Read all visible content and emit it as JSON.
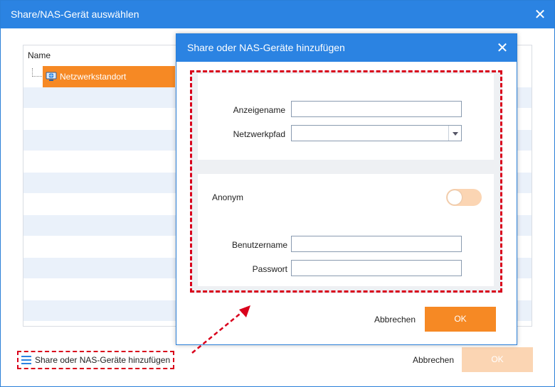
{
  "window": {
    "title": "Share/NAS-Gerät auswählen",
    "close_glyph": "✕"
  },
  "tree": {
    "column_header": "Name",
    "node_label": "Netzwerkstandort"
  },
  "footer": {
    "add_link_label": "Share oder NAS-Geräte hinzufügen",
    "cancel_label": "Abbrechen",
    "ok_label": "OK"
  },
  "dialog": {
    "title": "Share oder NAS-Geräte hinzufügen",
    "close_glyph": "✕",
    "display_name_label": "Anzeigename",
    "display_name_value": "",
    "network_path_label": "Netzwerkpfad",
    "network_path_value": "",
    "anonymous_label": "Anonym",
    "anonymous_enabled": false,
    "username_label": "Benutzername",
    "username_value": "",
    "password_label": "Passwort",
    "password_value": "",
    "cancel_label": "Abbrechen",
    "ok_label": "OK"
  },
  "colors": {
    "titlebar": "#2b83e2",
    "accent": "#f68924",
    "accent_disabled": "#fbd5b3",
    "highlight": "#d9001b"
  },
  "icons": {
    "node_icon": "network-globe-icon",
    "add_icon": "list-icon",
    "close_icon": "close-icon"
  }
}
